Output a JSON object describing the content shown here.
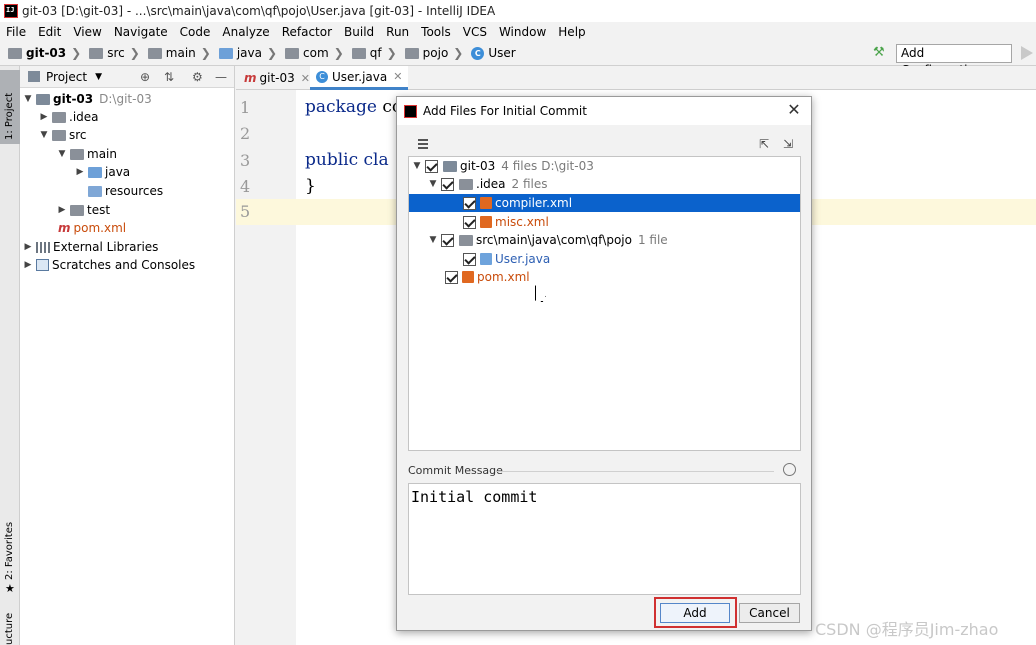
{
  "window": {
    "title": "git-03 [D:\\git-03] - ...\\src\\main\\java\\com\\qf\\pojo\\User.java [git-03] - IntelliJ IDEA"
  },
  "menu": [
    "File",
    "Edit",
    "View",
    "Navigate",
    "Code",
    "Analyze",
    "Refactor",
    "Build",
    "Run",
    "Tools",
    "VCS",
    "Window",
    "Help"
  ],
  "breadcrumb": [
    "git-03",
    "src",
    "main",
    "java",
    "com",
    "qf",
    "pojo",
    "User"
  ],
  "toolbar": {
    "add_config": "Add Configuration..."
  },
  "left_strip": {
    "project": "1: Project",
    "favorites": "2: Favorites",
    "structure": "ucture"
  },
  "project": {
    "header": "Project",
    "root_name": "git-03",
    "root_path": "D:\\git-03",
    "items": [
      ".idea",
      "src",
      "main",
      "java",
      "resources",
      "test",
      "pom.xml",
      "External Libraries",
      "Scratches and Consoles"
    ]
  },
  "editor": {
    "tabs": [
      "git-03",
      "User.java"
    ],
    "line_numbers": [
      "1",
      "2",
      "3",
      "4",
      "5"
    ],
    "line1_kw": "package",
    "line1_rest": "co",
    "line3_kw": "public",
    "line3_rest": "cla",
    "line4": "}"
  },
  "dialog": {
    "title": "Add Files For Initial Commit",
    "tree": {
      "root": {
        "name": "git-03",
        "count": "4 files",
        "path": "D:\\git-03"
      },
      "idea": {
        "name": ".idea",
        "count": "2 files"
      },
      "compiler": "compiler.xml",
      "misc": "misc.xml",
      "pojo": {
        "name": "src\\main\\java\\com\\qf\\pojo",
        "count": "1 file"
      },
      "user": "User.java",
      "pom": "pom.xml"
    },
    "commit_label": "Commit Message",
    "commit_message": "Initial commit",
    "add": "Add",
    "cancel": "Cancel"
  },
  "watermark": "CSDN @程序员Jim-zhao",
  "colors": {
    "selection": "#0b62cc",
    "highlight_box": "#d03030",
    "keyword": "#0b2a8a"
  }
}
